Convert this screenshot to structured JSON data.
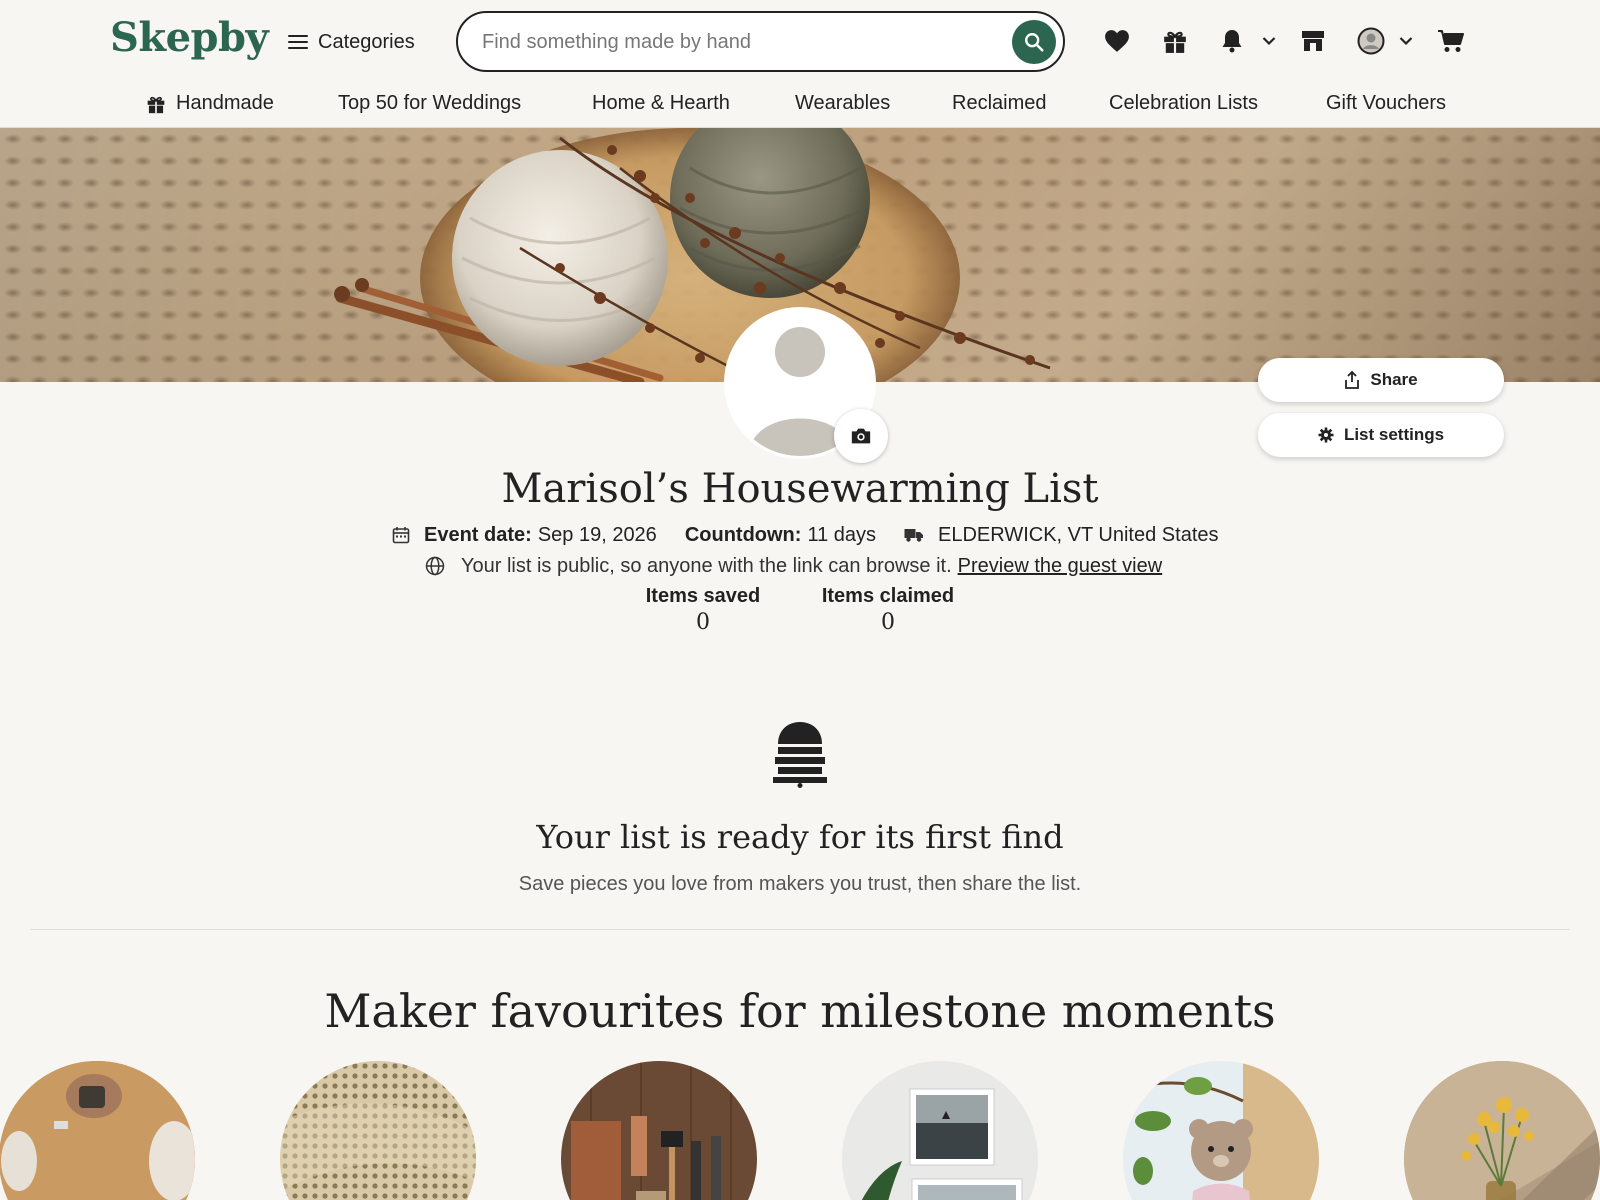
{
  "header": {
    "logo": "Skepby",
    "categories_label": "Categories",
    "search_placeholder": "Find something made by hand",
    "search_value": ""
  },
  "nav": {
    "items": [
      "Handmade",
      "Top 50 for Weddings",
      "Home & Hearth",
      "Wearables",
      "Reclaimed",
      "Celebration Lists",
      "Gift Vouchers"
    ]
  },
  "actions": {
    "share": "Share",
    "settings": "List settings"
  },
  "list": {
    "title": "Marisol’s Housewarming List",
    "event_date_label": "Event date:",
    "event_date": "Sep 19, 2026",
    "countdown_label": "Countdown:",
    "countdown": "11 days",
    "location": "ELDERWICK, VT United States",
    "public_text": "Your list is public, so anyone with the link can browse it.",
    "preview_link": "Preview the guest view",
    "stats": [
      {
        "label": "Items saved",
        "value": "0"
      },
      {
        "label": "Items claimed",
        "value": "0"
      }
    ]
  },
  "empty_state": {
    "title": "Your list is ready for its first find",
    "subtitle": "Save pieces you love from makers you trust, then share the list."
  },
  "section": {
    "title": "Maker favourites for milestone moments"
  },
  "colors": {
    "brand": "#2c6651",
    "background": "#f8f6f3",
    "text": "#222222"
  }
}
